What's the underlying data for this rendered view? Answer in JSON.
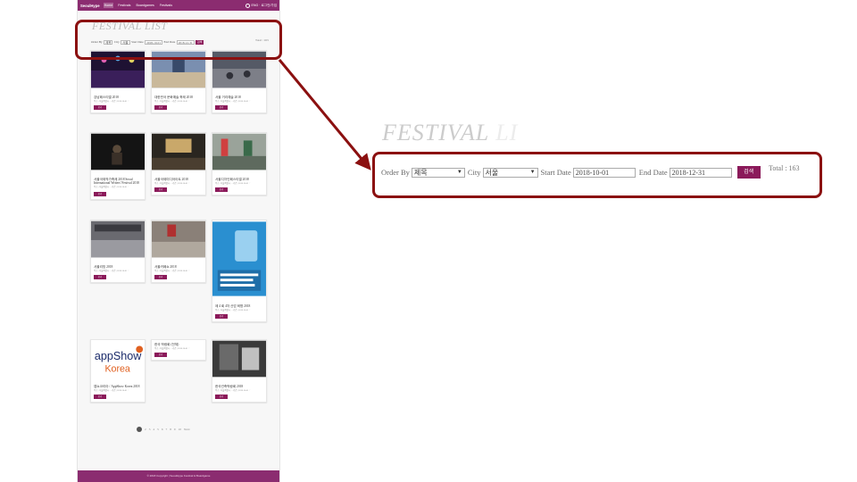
{
  "page": {
    "navbar": {
      "brand": "SeoulHype",
      "items": [
        "Home",
        "Festivals",
        "Boardgames",
        "Festivals"
      ],
      "right_label": "ENG · 로그인/가입"
    },
    "title": "FESTIVAL LIST",
    "filter": {
      "order_label": "Order By",
      "order_value": "제목",
      "city_label": "City",
      "city_value": "서울",
      "start_label": "Start Date",
      "start_value": "2018-10-01",
      "end_label": "End Date",
      "end_value": "2018-12-31",
      "button": "검색",
      "total": "Total : 163"
    },
    "cards": [
      {
        "title": "강남페스티벌 2018",
        "button": "보기"
      },
      {
        "title": "대한민국 문화예술 축제 2018",
        "button": "보기"
      },
      {
        "title": "서울 거리예술 2018",
        "button": "보기"
      },
      {
        "title": "서울국제작가축제 2018 Seoul International Writers' Festival 2018",
        "button": "보기"
      },
      {
        "title": "서울국제미디어아트 2018",
        "button": "보기"
      },
      {
        "title": "서울디자인페스티벌 2018",
        "button": "보기"
      },
      {
        "title": "서울리빙 2018",
        "button": "보기"
      },
      {
        "title": "서울카페쇼 2018",
        "button": "보기"
      },
      {
        "title": "제 4 회 4차 산업 혁명 2018",
        "button": "보기"
      },
      {
        "title": "앱쇼코리아 / AppShow Korea 2018",
        "button": "보기"
      },
      {
        "title": "한국 박람회 (전체)",
        "button": "보기"
      },
      {
        "title": "한국건축박람회 2018",
        "button": "보기"
      }
    ],
    "card_info": "주소 | 서울특별시 ... 기간 | 2018-10-01 ~",
    "pager": [
      "1",
      "2",
      "3",
      "4",
      "5",
      "6",
      "7",
      "8",
      "9",
      "10",
      "Next"
    ],
    "footer": "© 2018 Copyright | SeoulHype Festival & Boardgame"
  },
  "zoom": {
    "title_main": "FESTIVAL",
    "title_faded": "LI",
    "order_label": "Order By",
    "order_value": "제목",
    "city_label": "City",
    "city_value": "서울",
    "start_label": "Start Date",
    "start_value": "2018-10-01",
    "end_label": "End Date",
    "end_value": "2018-12-31",
    "button": "검색",
    "total": "Total : 163"
  },
  "colors": {
    "accent": "#8b1a5a",
    "navbar": "#8b2c70",
    "highlight": "#8b1010"
  }
}
